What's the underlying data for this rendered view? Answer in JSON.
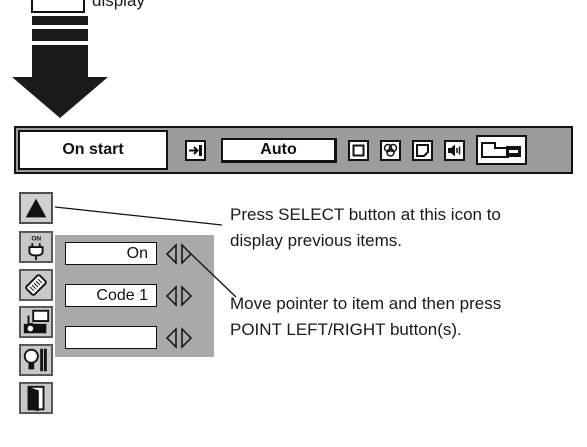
{
  "top_fragment": {
    "text": "display"
  },
  "menubar": {
    "mode_label": "On start",
    "input_value": "Auto",
    "icons": [
      "input-icon",
      "screen-icon",
      "color-icon",
      "image-icon",
      "sound-icon",
      "setting-icon"
    ]
  },
  "side_icons": [
    "up-arrow-icon",
    "power-on-icon",
    "remote-code-icon",
    "projector-icon",
    "lamp-tools-icon",
    "exit-door-icon"
  ],
  "fields": [
    {
      "value": "On"
    },
    {
      "value": "Code 1"
    },
    {
      "value": ""
    }
  ],
  "annotations": {
    "select_line1": "Press SELECT button at this icon to",
    "select_line2": "display previous items.",
    "pointer_line1": "Move pointer to item and then press",
    "pointer_line2": "POINT LEFT/RIGHT button(s)."
  }
}
